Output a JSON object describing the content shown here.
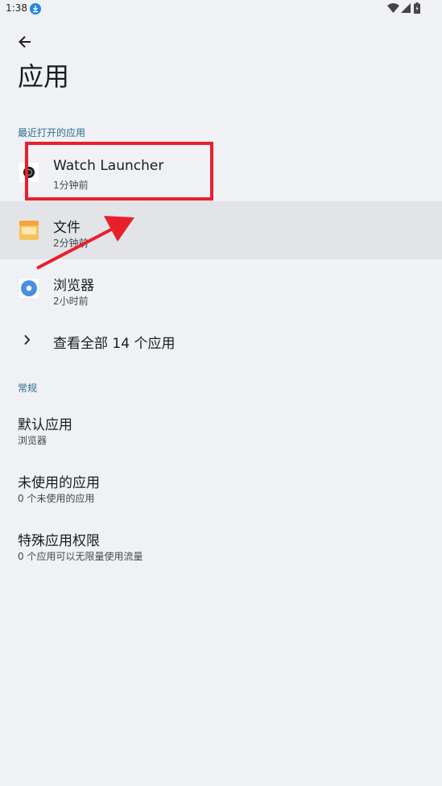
{
  "status_bar": {
    "time": "1:38",
    "icons": [
      "download-icon",
      "wifi-icon",
      "signal-icon",
      "battery-icon"
    ]
  },
  "header": {
    "back_icon": "arrow-back-icon",
    "title": "应用"
  },
  "recent": {
    "section_title": "最近打开的应用",
    "apps": [
      {
        "name": "Watch Launcher",
        "time": "1分钟前",
        "icon": "watch-launcher-icon"
      },
      {
        "name": "文件",
        "time": "2分钟前",
        "icon": "folder-icon"
      },
      {
        "name": "浏览器",
        "time": "2小时前",
        "icon": "browser-icon"
      }
    ],
    "see_all": "查看全部 14 个应用"
  },
  "general": {
    "section_title": "常规",
    "items": [
      {
        "title": "默认应用",
        "subtitle": "浏览器"
      },
      {
        "title": "未使用的应用",
        "subtitle": "0 个未使用的应用"
      },
      {
        "title": "特殊应用权限",
        "subtitle": "0 个应用可以无限量使用流量"
      }
    ]
  },
  "colors": {
    "background": "#eff1f5",
    "pressed_row": "#e2e4e8",
    "section_header": "#2f6d8c",
    "annotation": "#e8202a"
  }
}
